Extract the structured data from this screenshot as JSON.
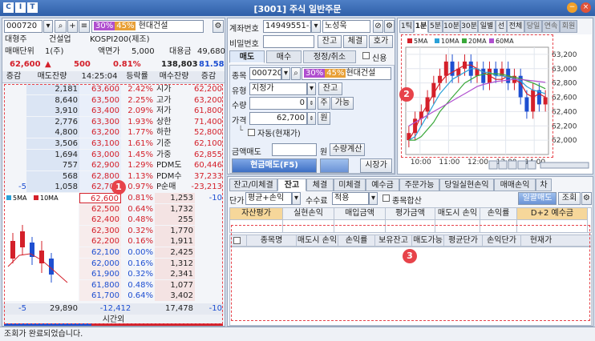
{
  "window": {
    "title": "[3001] 주식 일반주문",
    "logo_letters": [
      "C",
      "I",
      "T"
    ]
  },
  "left": {
    "code": "000720",
    "name": "현대건설",
    "tag30": "30%",
    "tag45": "45%",
    "info_row1": [
      "대형주",
      "건설업",
      "KOSPI200(제조)"
    ],
    "info_row2": {
      "unit_label": "매매단위",
      "unit_value": "1(주)",
      "par_label": "액면가",
      "par_value": "5,000",
      "loan_label": "대용금",
      "loan_value": "49,680"
    },
    "price_row": {
      "price": "62,600",
      "arrow": "▲",
      "change": "500",
      "rate": "0.81%",
      "volume": "138,803",
      "ratio": "81.58"
    },
    "book_header": [
      "증감",
      "매도잔량",
      "14:25:04",
      "등락률",
      "매수잔량",
      "증감"
    ],
    "asks": [
      {
        "qty": "2,181",
        "price": "63,600",
        "rate": "2.42%",
        "label": "시가",
        "lvalue": "62,200"
      },
      {
        "qty": "8,640",
        "price": "63,500",
        "rate": "2.25%",
        "label": "고가",
        "lvalue": "63,200"
      },
      {
        "qty": "3,910",
        "price": "63,400",
        "rate": "2.09%",
        "label": "저가",
        "lvalue": "61,800"
      },
      {
        "qty": "2,776",
        "price": "63,300",
        "rate": "1.93%",
        "label": "상한",
        "lvalue": "71,400"
      },
      {
        "qty": "4,800",
        "price": "63,200",
        "rate": "1.77%",
        "label": "하한",
        "lvalue": "52,800"
      },
      {
        "qty": "3,506",
        "price": "63,100",
        "rate": "1.61%",
        "label": "기준",
        "lvalue": "62,100"
      },
      {
        "qty": "1,694",
        "price": "63,000",
        "rate": "1.45%",
        "label": "가중",
        "lvalue": "62,855"
      },
      {
        "qty": "757",
        "price": "62,900",
        "rate": "1.29%",
        "label": "PDM도",
        "lvalue": "60,446"
      },
      {
        "qty": "568",
        "price": "62,800",
        "rate": "1.13%",
        "label": "PDM수",
        "lvalue": "37,233"
      },
      {
        "delta": "-5",
        "qty": "1,058",
        "price": "62,700",
        "rate": "0.97%",
        "label": "P순매",
        "lvalue": "-23,213"
      }
    ],
    "bids": [
      {
        "price": "62,600",
        "rate": "0.81%",
        "qty": "1,253",
        "delta": "-10"
      },
      {
        "price": "62,500",
        "rate": "0.64%",
        "qty": "1,732"
      },
      {
        "price": "62,400",
        "rate": "0.48%",
        "qty": "255"
      },
      {
        "price": "62,300",
        "rate": "0.32%",
        "qty": "1,770"
      },
      {
        "price": "62,200",
        "rate": "0.16%",
        "qty": "1,911"
      },
      {
        "price": "62,100",
        "rate": "0.00%",
        "qty": "2,425"
      },
      {
        "price": "62,000",
        "rate": "0.16%",
        "qty": "1,312"
      },
      {
        "price": "61,900",
        "rate": "0.32%",
        "qty": "2,341"
      },
      {
        "price": "61,800",
        "rate": "0.48%",
        "qty": "1,077"
      },
      {
        "price": "61,700",
        "rate": "0.64%",
        "qty": "3,402"
      }
    ],
    "mini_legend": [
      "5MA",
      "10MA"
    ],
    "totals": {
      "delta_left": "-5",
      "ask_total": "29,890",
      "diff": "-12,412",
      "bid_total": "17,478",
      "delta_right": "-10"
    },
    "after_hours": "시간외",
    "badge": "1"
  },
  "order": {
    "account_label": "계좌번호",
    "account": "14949551-11",
    "owner": "노성욱",
    "pw_label": "비밀번호",
    "pw_buttons": [
      "잔고",
      "체결",
      "호가"
    ],
    "tabs": [
      "매도",
      "매수",
      "정정/취소"
    ],
    "credit_label": "신용",
    "stock_label": "종목",
    "code": "000720",
    "name": "현대건설",
    "tag30": "30%",
    "tag45": "45%",
    "type_label": "유형",
    "type_value": "지정가",
    "balance_btn": "잔고",
    "qty_label": "수량",
    "qty_value": "0",
    "qty_unit": "주",
    "possible_btn": "가능",
    "price_label": "가격",
    "price_value": "62,700",
    "price_unit": "원",
    "auto_label": "자동(현재가)",
    "amount_label": "금액매도",
    "amount_unit": "원",
    "calc_btn": "수량계산",
    "submit_btn": "현금매도(F5)",
    "market_btn": "시장가"
  },
  "chart_panel": {
    "tabs": [
      "1틱",
      "1분",
      "5분",
      "10분",
      "30분",
      "일별",
      "선",
      "전체",
      "당일",
      "연속",
      "회원"
    ],
    "badge": "2"
  },
  "chart_data": {
    "type": "line",
    "legend": [
      {
        "name": "5MA",
        "color": "#d4202a"
      },
      {
        "name": "10MA",
        "color": "#2aa1d8"
      },
      {
        "name": "20MA",
        "color": "#3aa83a"
      },
      {
        "name": "60MA",
        "color": "#b04fcf"
      }
    ],
    "x_ticks": [
      "10:00",
      "11:00",
      "12:00",
      "13:00",
      "14:00"
    ],
    "y_ticks": [
      "63,200",
      "63,000",
      "62,800",
      "62,600",
      "62,400",
      "62,200",
      "62,000"
    ],
    "ylim": [
      61800,
      63300
    ],
    "series": [
      {
        "name": "5MA",
        "color": "#d4202a",
        "values": [
          62000,
          62150,
          62350,
          62500,
          62650,
          62800,
          62900,
          62950,
          63000,
          63050,
          63050,
          63000,
          62950,
          62900,
          62850,
          62850,
          62900,
          62850,
          62800,
          62650,
          62600,
          62650,
          62600
        ]
      },
      {
        "name": "10MA",
        "color": "#2aa1d8",
        "values": [
          62000,
          62050,
          62200,
          62350,
          62500,
          62650,
          62750,
          62850,
          62900,
          62950,
          63000,
          63000,
          62950,
          62950,
          62900,
          62900,
          62880,
          62860,
          62830,
          62750,
          62700,
          62680,
          62650
        ]
      },
      {
        "name": "20MA",
        "color": "#3aa83a",
        "values": [
          62000,
          62000,
          62050,
          62150,
          62250,
          62400,
          62500,
          62600,
          62700,
          62800,
          62850,
          62900,
          62920,
          62930,
          62930,
          62920,
          62900,
          62880,
          62860,
          62830,
          62800,
          62760,
          62720
        ]
      },
      {
        "name": "60MA",
        "color": "#b04fcf",
        "values": [
          62200,
          62250,
          62300,
          62350,
          62400,
          62450,
          62500,
          62550,
          62600,
          62650,
          62700,
          62750,
          62780,
          62800,
          62820,
          62830,
          62840,
          62850,
          62850,
          62840,
          62830,
          62820,
          62810
        ]
      }
    ],
    "candles": [
      {
        "o": 62000,
        "c": 62100,
        "h": 62200,
        "l": 61900
      },
      {
        "o": 62100,
        "c": 62300,
        "h": 62400,
        "l": 62000
      },
      {
        "o": 62300,
        "c": 62400,
        "h": 62500,
        "l": 62200
      },
      {
        "o": 62400,
        "c": 62600,
        "h": 62700,
        "l": 62300
      },
      {
        "o": 62600,
        "c": 62800,
        "h": 62900,
        "l": 62500
      },
      {
        "o": 62800,
        "c": 62900,
        "h": 63000,
        "l": 62700
      },
      {
        "o": 62900,
        "c": 63100,
        "h": 63200,
        "l": 62800
      },
      {
        "o": 63100,
        "c": 62900,
        "h": 63200,
        "l": 62800
      },
      {
        "o": 62900,
        "c": 63000,
        "h": 63100,
        "l": 62800
      },
      {
        "o": 63000,
        "c": 63100,
        "h": 63200,
        "l": 62900
      },
      {
        "o": 63100,
        "c": 62900,
        "h": 63200,
        "l": 62800
      },
      {
        "o": 62900,
        "c": 63000,
        "h": 63100,
        "l": 62800
      },
      {
        "o": 63000,
        "c": 62800,
        "h": 63100,
        "l": 62700
      },
      {
        "o": 62800,
        "c": 63000,
        "h": 63100,
        "l": 62700
      },
      {
        "o": 63000,
        "c": 62900,
        "h": 63100,
        "l": 62800
      },
      {
        "o": 62900,
        "c": 63000,
        "h": 63100,
        "l": 62800
      },
      {
        "o": 63000,
        "c": 62800,
        "h": 63100,
        "l": 62700
      },
      {
        "o": 62800,
        "c": 62900,
        "h": 63000,
        "l": 62700
      },
      {
        "o": 62900,
        "c": 62600,
        "h": 63000,
        "l": 62500
      },
      {
        "o": 62600,
        "c": 62400,
        "h": 62700,
        "l": 62300
      },
      {
        "o": 62400,
        "c": 62700,
        "h": 62800,
        "l": 62300
      },
      {
        "o": 62700,
        "c": 62500,
        "h": 62800,
        "l": 62400
      },
      {
        "o": 62500,
        "c": 62600,
        "h": 62700,
        "l": 62400
      }
    ]
  },
  "bottom": {
    "tabs": [
      "잔고/미체결",
      "잔고",
      "체결",
      "미체결",
      "예수금",
      "주문가능",
      "당일실현손익",
      "매매손익",
      "차"
    ],
    "active_tab": 1,
    "filter_label": "단가",
    "filter_value": "평균+손익",
    "fee_label": "수수료",
    "fee_value": "적용",
    "merge_label": "종목합산",
    "bulk_btn": "일괄매도",
    "query_btn": "조회",
    "summary_headers": [
      "자산평가",
      "실현손익",
      "매입금액",
      "평가금액",
      "매도시 손익",
      "손익률",
      "D+2 예수금"
    ],
    "table_headers": [
      "종목명",
      "매도시 손익",
      "손익률",
      "보유잔고",
      "매도가능",
      "평균단가",
      "손익단가",
      "현재가"
    ],
    "badge": "3"
  },
  "status": "조회가 완료되었습니다."
}
